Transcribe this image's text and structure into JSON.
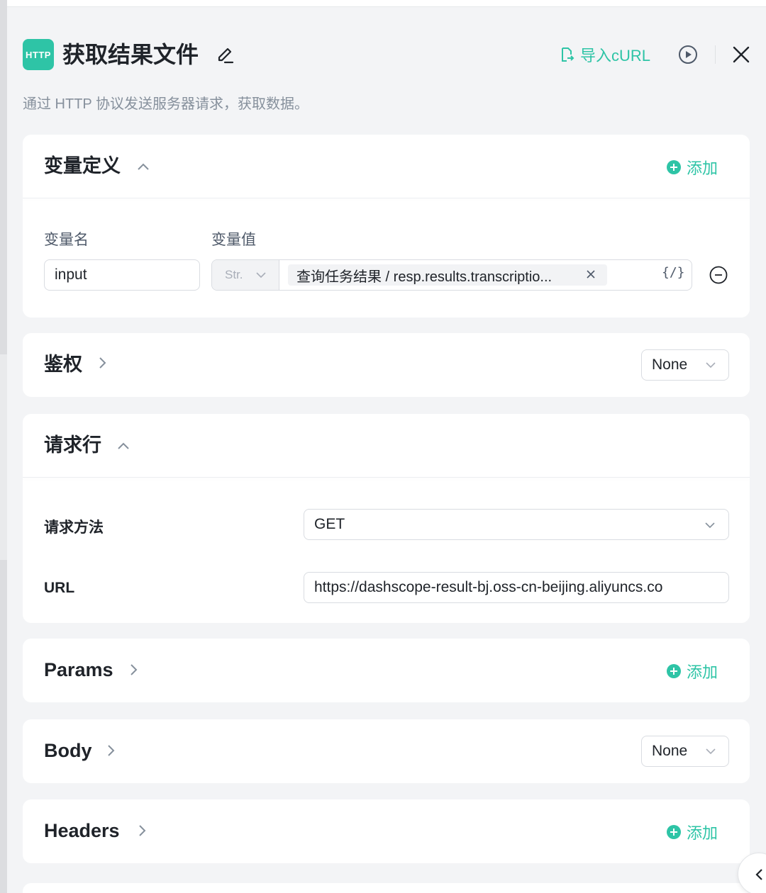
{
  "header": {
    "badge": "HTTP",
    "title": "获取结果文件",
    "import_label": "导入cURL",
    "accent": "#2ec4a6",
    "icons": [
      "edit-icon",
      "import-file-icon",
      "play-icon",
      "close-icon"
    ]
  },
  "description": "通过 HTTP 协议发送服务器请求，获取数据。",
  "variables": {
    "section_label": "变量定义",
    "add_label": "添加",
    "name_col": "变量名",
    "value_col": "变量值",
    "row": {
      "name": "input",
      "type": "Str.",
      "reference": "查询任务结果 / resp.results.transcriptio...",
      "code_toggle": "{/}"
    }
  },
  "auth": {
    "section_label": "鉴权",
    "selected": "None"
  },
  "request_line": {
    "section_label": "请求行",
    "method_label": "请求方法",
    "method_value": "GET",
    "url_label": "URL",
    "url_value": "https://dashscope-result-bj.oss-cn-beijing.aliyuncs.co"
  },
  "params": {
    "section_label": "Params",
    "add_label": "添加"
  },
  "body": {
    "section_label": "Body",
    "selected": "None"
  },
  "headers": {
    "section_label": "Headers",
    "add_label": "添加"
  }
}
